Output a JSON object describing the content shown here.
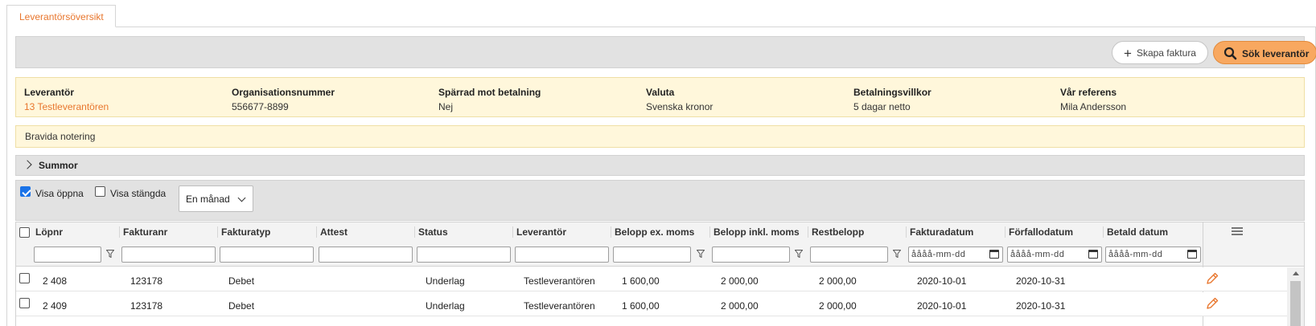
{
  "tabs": [
    {
      "label": "Leverantörsöversikt",
      "active": true
    }
  ],
  "toolbar": {
    "create_label": "Skapa faktura",
    "search_label": "Sök leverantör",
    "accent": "#f8a860"
  },
  "supplier": {
    "fields": [
      {
        "label": "Leverantör",
        "value": "13 Testleverantören",
        "link": true
      },
      {
        "label": "Organisationsnummer",
        "value": "556677-8899"
      },
      {
        "label": "Spärrad mot betalning",
        "value": "Nej"
      },
      {
        "label": "Valuta",
        "value": "Svenska kronor"
      },
      {
        "label": "Betalningsvillkor",
        "value": "5 dagar netto"
      },
      {
        "label": "Vår referens",
        "value": "Mila Andersson"
      }
    ],
    "note": "Bravida notering"
  },
  "summary": {
    "label": "Summor",
    "expanded": false
  },
  "filters": {
    "show_open": {
      "label": "Visa öppna",
      "checked": true
    },
    "show_closed": {
      "label": "Visa stängda",
      "checked": false
    },
    "period": {
      "value": "En månad"
    }
  },
  "table": {
    "columns": [
      "Löpnr",
      "Fakturanr",
      "Fakturatyp",
      "Attest",
      "Status",
      "Leverantör",
      "Belopp ex. moms",
      "Belopp inkl. moms",
      "Restbelopp",
      "Fakturadatum",
      "Förfallodatum",
      "Betald datum"
    ],
    "date_placeholder": "åååå-mm-dd",
    "rows": [
      [
        "2 408",
        "123178",
        "Debet",
        "",
        "Underlag",
        "Testleverantören",
        "1 600,00",
        "2 000,00",
        "2 000,00",
        "2020-10-01",
        "2020-10-31",
        ""
      ],
      [
        "2 409",
        "123178",
        "Debet",
        "",
        "Underlag",
        "Testleverantören",
        "1 600,00",
        "2 000,00",
        "2 000,00",
        "2020-10-01",
        "2020-10-31",
        ""
      ]
    ]
  },
  "colors": {
    "link": "#e8762d",
    "info_bg": "#fff7db",
    "bar_bg": "#e2e2e2"
  },
  "icons": [
    "plus-icon",
    "search-icon",
    "chevron-right-icon",
    "funnel-icon",
    "calendar-icon",
    "menu-icon",
    "pencil-icon"
  ]
}
